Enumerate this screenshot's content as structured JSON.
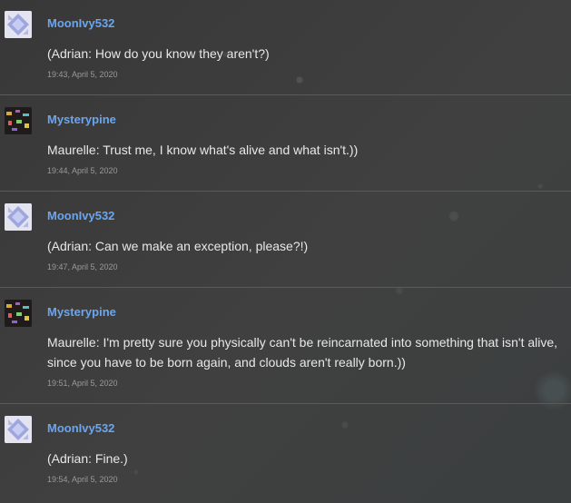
{
  "posts": [
    {
      "user": "MoonIvy532",
      "avatar_icon": "crystal-avatar-icon",
      "message": "(Adrian: How do you know they aren't?)",
      "time": "19:43, April 5, 2020"
    },
    {
      "user": "Mysterypine",
      "avatar_icon": "mystery-avatar-icon",
      "message": "Maurelle: Trust me, I know what's alive and what isn't.))",
      "time": "19:44, April 5, 2020"
    },
    {
      "user": "MoonIvy532",
      "avatar_icon": "crystal-avatar-icon",
      "message": "(Adrian: Can we make an exception, please?!)",
      "time": "19:47, April 5, 2020"
    },
    {
      "user": "Mysterypine",
      "avatar_icon": "mystery-avatar-icon",
      "message": "Maurelle: I'm pretty sure you physically can't be reincarnated into something that isn't alive, since you have to be born again, and clouds aren't really born.))",
      "time": "19:51, April 5, 2020"
    },
    {
      "user": "MoonIvy532",
      "avatar_icon": "crystal-avatar-icon",
      "message": "(Adrian: Fine.)",
      "time": "19:54, April 5, 2020"
    }
  ]
}
